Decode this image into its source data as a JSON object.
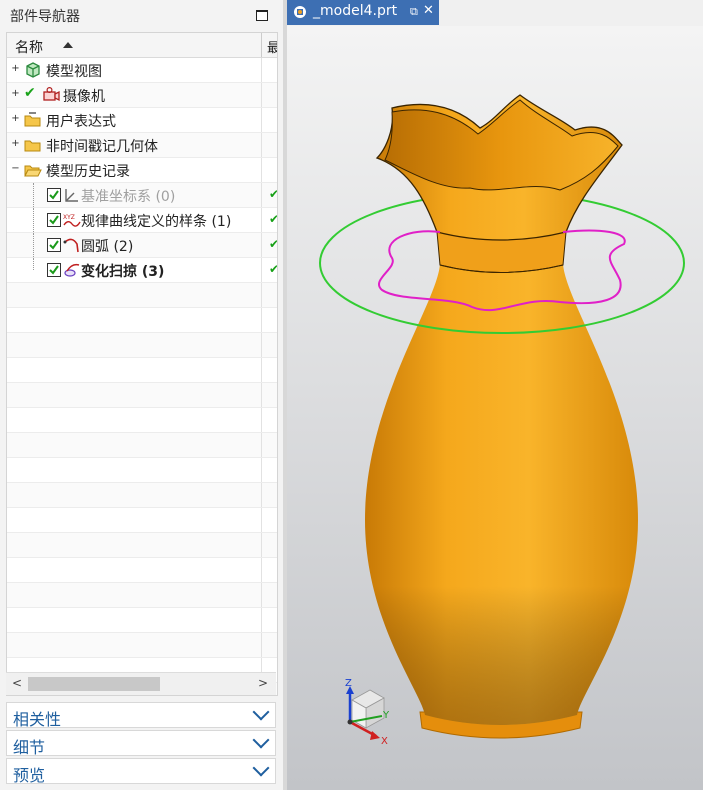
{
  "navigator": {
    "title": "部件导航器",
    "column_name": "名称",
    "column_extra": "最",
    "rows": [
      {
        "label": "模型视图"
      },
      {
        "label": "摄像机"
      },
      {
        "label": "用户表达式"
      },
      {
        "label": "非时间戳记几何体"
      },
      {
        "label": "模型历史记录"
      },
      {
        "label": "基准坐标系 (0)"
      },
      {
        "label": "规律曲线定义的样条 (1)"
      },
      {
        "label": "圆弧 (2)"
      },
      {
        "label": "变化扫掠 (3)"
      }
    ],
    "panels": [
      {
        "label": "相关性"
      },
      {
        "label": "细节"
      },
      {
        "label": "预览"
      }
    ]
  },
  "tab": {
    "title": "_model4.prt"
  },
  "viewport": {
    "vase_color": "#f39c12",
    "guide_circle_color": "#33cc33",
    "profile_curve_color": "#e020c8",
    "triad": {
      "x": "X",
      "y": "Y",
      "z": "Z"
    }
  },
  "colors": {
    "tab_active": "#3d6fb3",
    "panel_text": "#1f5f9f",
    "status_ok": "#17a017"
  }
}
